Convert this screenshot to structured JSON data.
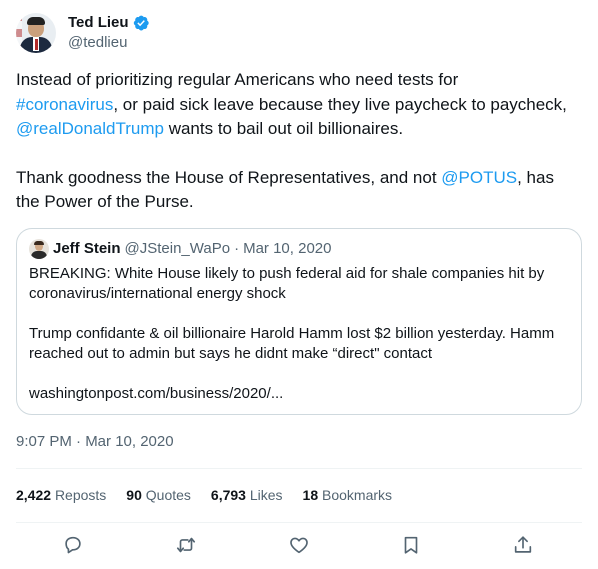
{
  "author": {
    "name": "Ted Lieu",
    "handle": "@tedlieu",
    "verified": true,
    "avatar_icon": "avatar-photo"
  },
  "tweet": {
    "paragraph1": {
      "t1": "Instead of prioritizing regular Americans who need tests for",
      "hashtag": "#coronavirus",
      "t2": ", or paid sick leave because they live paycheck to paycheck, ",
      "mention": "@realDonaldTrump",
      "t3": " wants to bail out oil billionaires."
    },
    "paragraph2": {
      "t1": "Thank goodness the House of Representatives, and not ",
      "mention": "@POTUS",
      "t2": ", has the Power of the Purse."
    }
  },
  "quote": {
    "author_name": "Jeff Stein",
    "author_handle": "@JStein_WaPo",
    "separator": "·",
    "date": "Mar 10, 2020",
    "line1": "BREAKING: White House likely to push federal aid for shale companies hit by coronavirus/international energy shock",
    "line2": "Trump confidante & oil billionaire Harold Hamm lost $2 billion yesterday. Hamm reached out to admin but says he didnt make “direct\" contact",
    "link": "washingtonpost.com/business/2020/..."
  },
  "timestamp": "9:07 PM · Mar 10, 2020",
  "stats": {
    "reposts_count": "2,422",
    "reposts_label": "Reposts",
    "quotes_count": "90",
    "quotes_label": "Quotes",
    "likes_count": "6,793",
    "likes_label": "Likes",
    "bookmarks_count": "18",
    "bookmarks_label": "Bookmarks"
  },
  "actions": [
    "reply-icon",
    "repost-icon",
    "like-icon",
    "bookmark-icon",
    "share-icon"
  ],
  "colors": {
    "link": "#1d9bf0",
    "secondary_text": "#536471",
    "border": "#cfd9de",
    "verified": "#1d9bf0"
  }
}
